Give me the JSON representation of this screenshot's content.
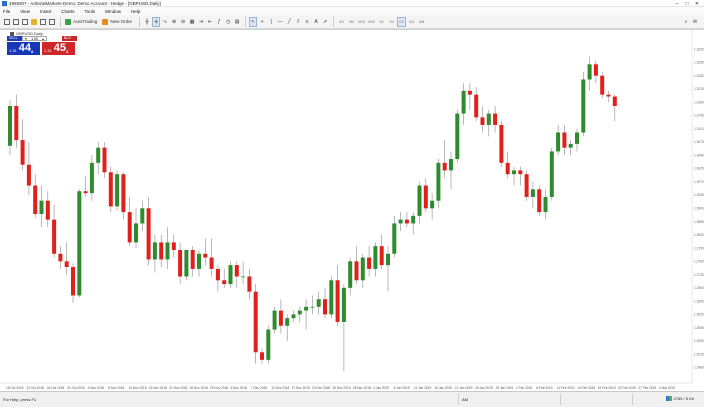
{
  "window": {
    "title": "4969307 - AdmiralMarkets-Demo: Demo Account - Hedge - [GBPUSD,Daily]",
    "controls": [
      "–",
      "□",
      "✕"
    ]
  },
  "menu": [
    "File",
    "View",
    "Insert",
    "Charts",
    "Tools",
    "Window",
    "Help"
  ],
  "toolbar": {
    "autotrading_label": "AutoTrading",
    "new_order_label": "New Order",
    "timeframes": [
      "M1",
      "M5",
      "M15",
      "M30",
      "H1",
      "H4",
      "D1",
      "W1",
      "MN"
    ],
    "active_timeframe": "D1"
  },
  "chart": {
    "symbol_label": "GBPUSD,Daily",
    "one_click": {
      "sell_label": "SELL",
      "buy_label": "BUY",
      "lot_value": "1.00",
      "sell_price_prefix": "1.31",
      "sell_price_big": "44",
      "sell_price_sup": "8",
      "buy_price_prefix": "1.31",
      "buy_price_big": "45",
      "buy_price_sup": "3"
    },
    "x_labels": [
      "18 Oct 2018",
      "23 Oct 2018",
      "26 Oct 2018",
      "31 Oct 2018",
      "5 Nov 2018",
      "8 Nov 2018",
      "13 Nov 2018",
      "16 Nov 2018",
      "21 Nov 2018",
      "26 Nov 2018",
      "29 Nov 2018",
      "4 Dec 2018",
      "7 Dec 2018",
      "12 Dec 2018",
      "17 Dec 2018",
      "20 Dec 2018",
      "25 Dec 2018",
      "28 Dec 2018",
      "3 Jan 2019",
      "8 Jan 2019",
      "11 Jan 2019",
      "16 Jan 2019",
      "21 Jan 2019",
      "24 Jan 2019",
      "29 Jan 2019",
      "1 Feb 2019",
      "6 Feb 2019",
      "11 Feb 2019",
      "14 Feb 2019",
      "19 Feb 2019",
      "22 Feb 2019",
      "27 Feb 2019",
      "4 Mar 2019"
    ],
    "up_color": "#2e8b2e",
    "down_color": "#e0201b",
    "candles": [
      [
        1.3065,
        1.3185,
        1.304,
        1.317
      ],
      [
        1.317,
        1.32,
        1.306,
        1.308
      ],
      [
        1.308,
        1.3135,
        1.3,
        1.3015
      ],
      [
        1.3015,
        1.3075,
        1.2935,
        1.296
      ],
      [
        1.296,
        1.299,
        1.2875,
        1.2885
      ],
      [
        1.2885,
        1.296,
        1.285,
        1.292
      ],
      [
        1.292,
        1.2945,
        1.285,
        1.287
      ],
      [
        1.287,
        1.291,
        1.277,
        1.278
      ],
      [
        1.278,
        1.28,
        1.274,
        1.276
      ],
      [
        1.276,
        1.281,
        1.2725,
        1.2745
      ],
      [
        1.2745,
        1.2755,
        1.265,
        1.267
      ],
      [
        1.267,
        1.295,
        1.2665,
        1.2945
      ],
      [
        1.2945,
        1.2985,
        1.293,
        1.294
      ],
      [
        1.294,
        1.304,
        1.292,
        1.302
      ],
      [
        1.302,
        1.3075,
        1.299,
        1.306
      ],
      [
        1.306,
        1.3075,
        1.298,
        1.2995
      ],
      [
        1.2995,
        1.301,
        1.289,
        1.2905
      ],
      [
        1.2905,
        1.3,
        1.2895,
        1.299
      ],
      [
        1.299,
        1.2995,
        1.287,
        1.289
      ],
      [
        1.289,
        1.293,
        1.28,
        1.281
      ],
      [
        1.281,
        1.29,
        1.2795,
        1.286
      ],
      [
        1.286,
        1.292,
        1.284,
        1.29
      ],
      [
        1.29,
        1.293,
        1.275,
        1.2765
      ],
      [
        1.2765,
        1.283,
        1.273,
        1.281
      ],
      [
        1.281,
        1.283,
        1.2745,
        1.2765
      ],
      [
        1.2765,
        1.285,
        1.274,
        1.281
      ],
      [
        1.281,
        1.283,
        1.277,
        1.279
      ],
      [
        1.279,
        1.281,
        1.27,
        1.272
      ],
      [
        1.272,
        1.279,
        1.271,
        1.279
      ],
      [
        1.279,
        1.28,
        1.272,
        1.274
      ],
      [
        1.274,
        1.279,
        1.272,
        1.278
      ],
      [
        1.278,
        1.282,
        1.275,
        1.277
      ],
      [
        1.277,
        1.282,
        1.272,
        1.274
      ],
      [
        1.274,
        1.275,
        1.268,
        1.271
      ],
      [
        1.271,
        1.274,
        1.269,
        1.27
      ],
      [
        1.27,
        1.276,
        1.269,
        1.275
      ],
      [
        1.275,
        1.276,
        1.269,
        1.272
      ],
      [
        1.272,
        1.276,
        1.27,
        1.272
      ],
      [
        1.272,
        1.274,
        1.266,
        1.268
      ],
      [
        1.268,
        1.27,
        1.249,
        1.252
      ],
      [
        1.252,
        1.253,
        1.249,
        1.25
      ],
      [
        1.25,
        1.259,
        1.249,
        1.258
      ],
      [
        1.258,
        1.264,
        1.257,
        1.263
      ],
      [
        1.263,
        1.266,
        1.257,
        1.259
      ],
      [
        1.259,
        1.262,
        1.255,
        1.261
      ],
      [
        1.261,
        1.263,
        1.26,
        1.262
      ],
      [
        1.262,
        1.264,
        1.26,
        1.263
      ],
      [
        1.263,
        1.266,
        1.258,
        1.264
      ],
      [
        1.264,
        1.267,
        1.262,
        1.264
      ],
      [
        1.264,
        1.268,
        1.262,
        1.266
      ],
      [
        1.266,
        1.269,
        1.261,
        1.262
      ],
      [
        1.262,
        1.272,
        1.261,
        1.271
      ],
      [
        1.271,
        1.275,
        1.259,
        1.26
      ],
      [
        1.26,
        1.27,
        1.247,
        1.269
      ],
      [
        1.269,
        1.277,
        1.267,
        1.276
      ],
      [
        1.276,
        1.28,
        1.27,
        1.271
      ],
      [
        1.271,
        1.278,
        1.269,
        1.277
      ],
      [
        1.277,
        1.28,
        1.272,
        1.274
      ],
      [
        1.274,
        1.281,
        1.272,
        1.28
      ],
      [
        1.28,
        1.283,
        1.274,
        1.275
      ],
      [
        1.275,
        1.28,
        1.268,
        1.278
      ],
      [
        1.278,
        1.288,
        1.277,
        1.286
      ],
      [
        1.286,
        1.289,
        1.284,
        1.287
      ],
      [
        1.287,
        1.289,
        1.285,
        1.286
      ],
      [
        1.286,
        1.289,
        1.283,
        1.288
      ],
      [
        1.288,
        1.297,
        1.286,
        1.296
      ],
      [
        1.296,
        1.298,
        1.289,
        1.29
      ],
      [
        1.29,
        1.294,
        1.287,
        1.292
      ],
      [
        1.292,
        1.303,
        1.29,
        1.302
      ],
      [
        1.302,
        1.308,
        1.298,
        1.3
      ],
      [
        1.3,
        1.305,
        1.295,
        1.303
      ],
      [
        1.303,
        1.316,
        1.302,
        1.315
      ],
      [
        1.315,
        1.323,
        1.312,
        1.321
      ],
      [
        1.321,
        1.323,
        1.316,
        1.32
      ],
      [
        1.32,
        1.322,
        1.313,
        1.314
      ],
      [
        1.314,
        1.317,
        1.31,
        1.312
      ],
      [
        1.312,
        1.316,
        1.309,
        1.315
      ],
      [
        1.315,
        1.317,
        1.31,
        1.312
      ],
      [
        1.312,
        1.313,
        1.301,
        1.302
      ],
      [
        1.302,
        1.305,
        1.298,
        1.299
      ],
      [
        1.299,
        1.301,
        1.296,
        1.3
      ],
      [
        1.3,
        1.301,
        1.296,
        1.299
      ],
      [
        1.299,
        1.3,
        1.292,
        1.293
      ],
      [
        1.293,
        1.297,
        1.29,
        1.295
      ],
      [
        1.295,
        1.296,
        1.288,
        1.289
      ],
      [
        1.289,
        1.295,
        1.287,
        1.293
      ],
      [
        1.293,
        1.306,
        1.292,
        1.305
      ],
      [
        1.305,
        1.312,
        1.304,
        1.31
      ],
      [
        1.31,
        1.312,
        1.304,
        1.306
      ],
      [
        1.306,
        1.308,
        1.304,
        1.307
      ],
      [
        1.307,
        1.311,
        1.305,
        1.31
      ],
      [
        1.31,
        1.326,
        1.309,
        1.324
      ],
      [
        1.324,
        1.33,
        1.321,
        1.328
      ],
      [
        1.328,
        1.329,
        1.323,
        1.325
      ],
      [
        1.325,
        1.326,
        1.319,
        1.32
      ],
      [
        1.32,
        1.321,
        1.318,
        1.3195
      ],
      [
        1.3195,
        1.32,
        1.313,
        1.317
      ]
    ]
  }
}
